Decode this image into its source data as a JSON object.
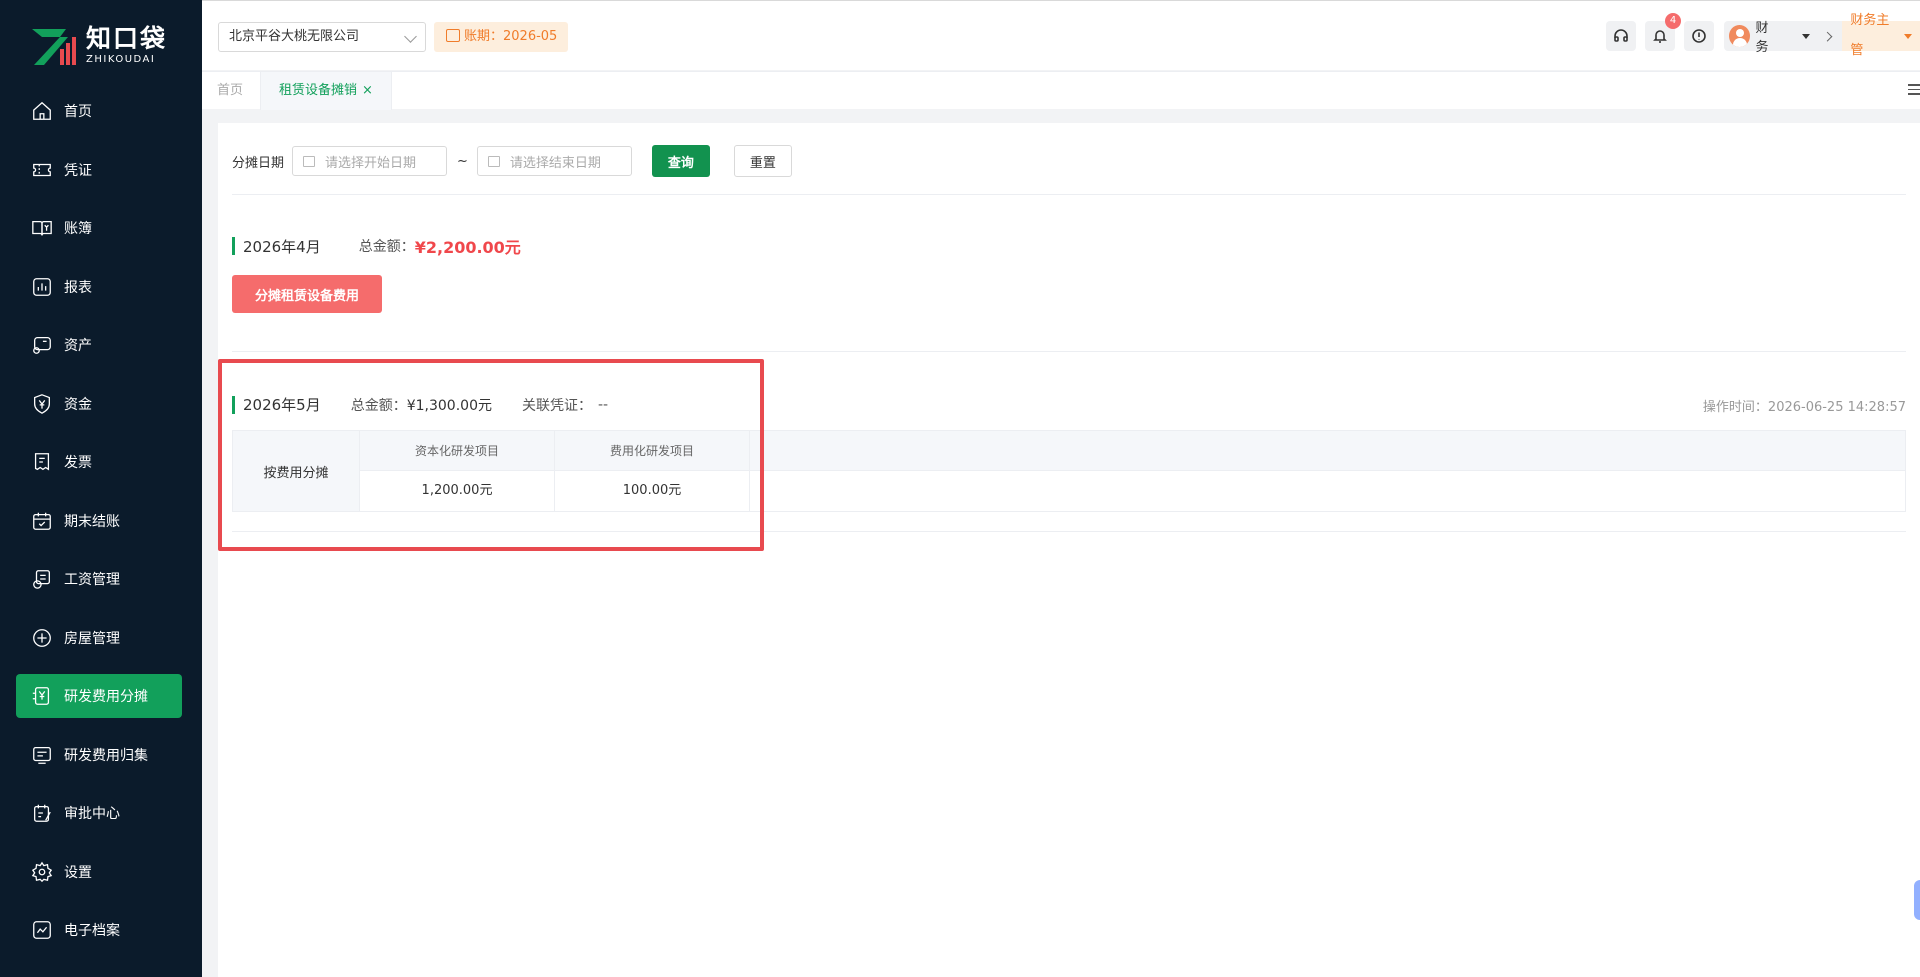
{
  "brand": {
    "name_cn": "知口袋",
    "name_en": "ZHIKOUDAI",
    "colors": {
      "green": "#12a05b",
      "red": "#f0474b",
      "orange": "#f07c2a",
      "sidebar": "#0b1b2b"
    }
  },
  "sidebar": {
    "items": [
      {
        "label": "首页",
        "icon": "home-icon"
      },
      {
        "label": "凭证",
        "icon": "voucher-icon"
      },
      {
        "label": "账簿",
        "icon": "ledger-book-icon"
      },
      {
        "label": "报表",
        "icon": "report-chart-icon"
      },
      {
        "label": "资产",
        "icon": "asset-icon"
      },
      {
        "label": "资金",
        "icon": "yuan-shield-icon"
      },
      {
        "label": "发票",
        "icon": "invoice-icon"
      },
      {
        "label": "期末结账",
        "icon": "calendar-check-icon"
      },
      {
        "label": "工资管理",
        "icon": "salary-icon"
      },
      {
        "label": "房屋管理",
        "icon": "house-icon"
      },
      {
        "label": "研发费用分摊",
        "icon": "rd-allocate-icon",
        "active": true
      },
      {
        "label": "研发费用归集",
        "icon": "rd-collect-icon"
      },
      {
        "label": "审批中心",
        "icon": "approval-icon"
      },
      {
        "label": "设置",
        "icon": "gear-icon"
      },
      {
        "label": "电子档案",
        "icon": "archive-icon"
      }
    ]
  },
  "header": {
    "company": "北京平谷大桃无限公司",
    "period": "账期：2026-05",
    "notification_count": "4",
    "user_name": "财务",
    "role": "财务主管"
  },
  "tabs": {
    "home": "首页",
    "active": "租赁设备摊销",
    "close": "×"
  },
  "filter": {
    "label": "分摊日期",
    "start_placeholder": "请选择开始日期",
    "tilde": "~",
    "end_placeholder": "请选择结束日期",
    "query": "查询",
    "reset": "重置"
  },
  "april": {
    "month": "2026年4月",
    "total_label": "总金额：",
    "total_value": "¥2,200.00元",
    "allocate_button": "分摊租赁设备费用"
  },
  "may": {
    "month": "2026年5月",
    "total_label": "总金额：",
    "total_value": "¥1,300.00元",
    "voucher_label": "关联凭证：",
    "voucher_value": "--",
    "op_time": "操作时间：2026-06-25 14:28:57",
    "table": {
      "row_label": "按费用分摊",
      "columns": [
        "资本化研发项目",
        "费用化研发项目"
      ],
      "values": [
        "1,200.00元",
        "100.00元"
      ]
    }
  }
}
